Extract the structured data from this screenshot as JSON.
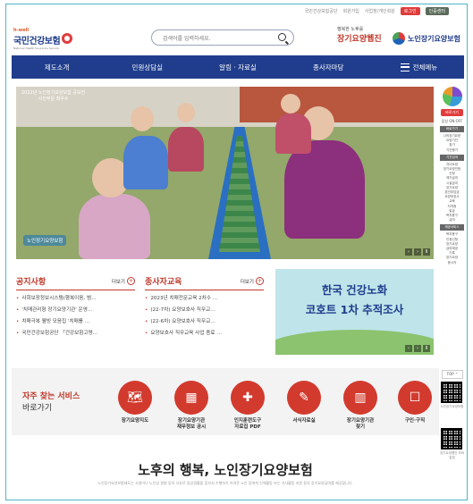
{
  "topbar": {
    "links": [
      "국민건강보험공단",
      "회원가입",
      "사업장/개인회원"
    ],
    "red_button": "로그인",
    "dark_button": "인증센터"
  },
  "logo": {
    "small": "h-well",
    "name": "국민건강보험",
    "sub": "National Health Insurance Service"
  },
  "search": {
    "placeholder": "검색어를 입력하세요."
  },
  "brand1": {
    "line1": "행복한 노후를",
    "line2": "장기요양웹진"
  },
  "brand2": {
    "name": "노인장기요양보험"
  },
  "nav": {
    "items": [
      "제도소개",
      "민원상담실",
      "알림 · 자료실",
      "종사자마당"
    ],
    "all_menu": "전체메뉴"
  },
  "hero": {
    "caption_line1": "2022년 노인장기요양보험 공모전",
    "caption_line2": "사진부문 최우수",
    "badge": "노인장기요양보험",
    "controls": [
      "‹",
      "›",
      "II"
    ]
  },
  "sidebar": {
    "quick_button": "바로가기",
    "toggle": "음성 ON·OFF",
    "heading1": "바로가기",
    "items1": [
      "나의장기요양",
      "요양기관",
      "찾기",
      "기관평가",
      "장기요양",
      "종사자",
      "자격확인",
      "장기요양"
    ],
    "heading2": "기관검색",
    "items2": [
      "자녀요양",
      "장기요양인정",
      "신청",
      "재가급여",
      "시설급여",
      "장기요양",
      "본인부담금",
      "요양보호사",
      "교육",
      "자격증",
      "발급",
      "복지용구",
      "급여",
      "기관",
      "조회"
    ],
    "heading3": "제공서비스",
    "items3": [
      "복지용구",
      "인정신청",
      "장기요양",
      "급여제공",
      "기록",
      "장기요양",
      "종사자",
      "처우개선",
      "법령정보"
    ],
    "top": "TOP ⌃",
    "qr1_caption": "노인장기요양보험",
    "qr2_caption": "장기요양웹진 모바일앱"
  },
  "notice": {
    "title": "공지사항",
    "more": "더보기",
    "items": [
      "사회보장정보시스템(행복이음, 범…",
      "'치매관리형 장기요양기관' 운영…",
      "치매극복 웰빙 모음집 '치매를 …",
      "국민건강보험공단 「건강보험고령…"
    ]
  },
  "education": {
    "title": "종사자교육",
    "more": "더보기",
    "items": [
      "2023년 치매전문교육 2차수 …",
      "(22-7차) 요양보호사 직무교…",
      "(22-6차) 요양보호사 직무교…",
      "요양보호사 직무교육 사업 종료 …"
    ]
  },
  "banner": {
    "line1": "한국 건강노화",
    "line2": "코호트 1차 추적조사",
    "controls": [
      "‹",
      "›",
      "II"
    ]
  },
  "services": {
    "title": "자주 찾는 서비스",
    "subtitle": "바로가기",
    "items": [
      {
        "label1": "장기요양지도",
        "label2": "",
        "icon": "map-icon",
        "glyph": "🗺"
      },
      {
        "label1": "장기요양기관",
        "label2": "재무정보 공시",
        "icon": "calculator-icon",
        "glyph": "▦"
      },
      {
        "label1": "인지훈련도구",
        "label2": "자료집 PDF",
        "icon": "pdf-document-icon",
        "glyph": "✚"
      },
      {
        "label1": "서식자료실",
        "label2": "",
        "icon": "form-document-icon",
        "glyph": "✎"
      },
      {
        "label1": "장기요양기관",
        "label2": "찾기",
        "icon": "building-icon",
        "glyph": "▥"
      },
      {
        "label1": "구인·구직",
        "label2": "",
        "icon": "job-icon",
        "glyph": "☐"
      }
    ]
  },
  "slogan": {
    "main": "노후의 행복, 노인장기요양보험",
    "sub": "노인장기요양보험제도는 고령이나 노인성 질병 등의 사유로 일상생활을 혼자서 수행하기 어려운 노인 등에게 신체활동 또는 가사활동 지원 등의 장기요양급여를 제공합니다."
  },
  "colors": {
    "nav_bg": "#1f3d8c",
    "accent_red": "#c0392b",
    "service_circle": "#d23a2e"
  }
}
